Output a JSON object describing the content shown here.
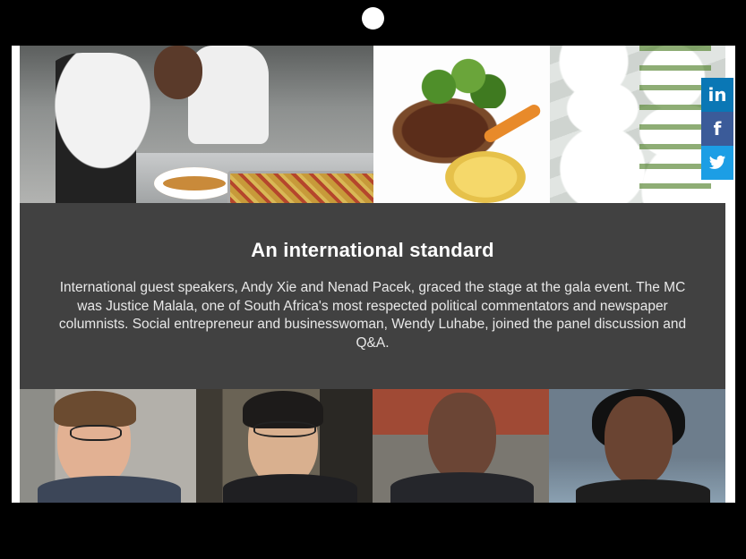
{
  "header": {
    "icon": "camera-dot-icon"
  },
  "gallery_top": {
    "images": [
      {
        "name": "chefs-plating-photo"
      },
      {
        "name": "steak-dish-photo"
      },
      {
        "name": "plated-rows-photo"
      }
    ]
  },
  "info": {
    "title": "An international standard",
    "text": "International guest speakers, Andy Xie and Nenad Pacek, graced the stage at the gala event. The MC was Justice Malala, one of South Africa's most respected political commentators and newspaper columnists. Social entrepreneur and businesswoman, Wendy Luhabe, joined the panel discussion and Q&A."
  },
  "gallery_bottom": {
    "portraits": [
      {
        "name": "speaker-portrait-1"
      },
      {
        "name": "speaker-portrait-2"
      },
      {
        "name": "speaker-portrait-3"
      },
      {
        "name": "speaker-portrait-4"
      }
    ]
  },
  "social": {
    "linkedin": {
      "label": "in",
      "color": "#0a77b5"
    },
    "facebook": {
      "label": "f",
      "color": "#3b5b99"
    },
    "twitter": {
      "icon": "twitter-icon",
      "color": "#1c9ee5"
    }
  },
  "colors": {
    "panel_background": "#414141",
    "page_background": "#000000"
  }
}
